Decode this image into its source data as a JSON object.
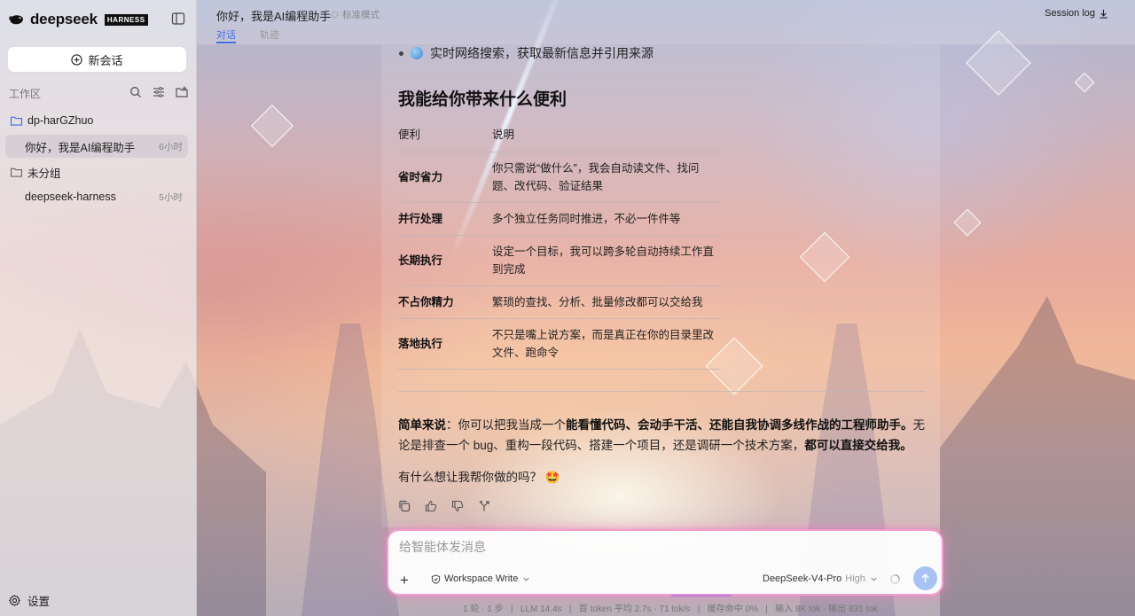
{
  "sidebar": {
    "brand_name": "deepseek",
    "brand_tag": "HARNESS",
    "new_chat_label": "新会话",
    "workspace_label": "工作区",
    "tree": [
      {
        "label": "dp-harGZhuo",
        "type": "folder",
        "time": ""
      },
      {
        "label": "你好，我是AI编程助手",
        "type": "chat",
        "time": "6小时",
        "selected": true
      },
      {
        "label": "未分组",
        "type": "folder",
        "time": ""
      },
      {
        "label": "deepseek-harness",
        "type": "chat",
        "time": "5小时"
      }
    ],
    "settings_label": "设置"
  },
  "header": {
    "title": "你好，我是AI编程助手",
    "mode": "标准模式",
    "tabs": [
      {
        "label": "对话",
        "active": true
      },
      {
        "label": "轨迹",
        "active": false
      }
    ],
    "session_log": "Session log"
  },
  "message": {
    "bullet": "实时网络搜索，获取最新信息并引用来源",
    "section_title": "我能给你带来什么便利",
    "table_headers": [
      "便利",
      "说明"
    ],
    "table_rows": [
      [
        "省时省力",
        "你只需说“做什么”，我会自动读文件、找问题、改代码、验证结果"
      ],
      [
        "并行处理",
        "多个独立任务同时推进，不必一件件等"
      ],
      [
        "长期执行",
        "设定一个目标，我可以跨多轮自动持续工作直到完成"
      ],
      [
        "不占你精力",
        "繁琐的查找、分析、批量修改都可以交给我"
      ],
      [
        "落地执行",
        "不只是嘴上说方案，而是真正在你的目录里改文件、跑命令"
      ]
    ],
    "summary_lead": "简单来说",
    "summary_part1": "：你可以把我当成一个",
    "summary_bold": "能看懂代码、会动手干活、还能自我协调多线作战的工程师助手。",
    "summary_part2": "无论是排查一个 bug、重构一段代码、搭建一个项目，还是调研一个技术方案，",
    "summary_bold2": "都可以直接交给我。",
    "question": "有什么想让我帮你做的吗？",
    "question_emoji": "🤩"
  },
  "composer": {
    "placeholder": "给智能体发消息",
    "value": "",
    "permission": "Workspace Write",
    "model": "DeepSeek-V4-Pro",
    "level": "High"
  },
  "status": {
    "text": "1 轮 · 1 步   |   LLM 14.4s   |   首 token 平均 2.7s · 71 tok/s   |   缓存命中 0%   |   输入 8K tok · 输出 831 tok"
  },
  "colors": {
    "accent": "#3f6fe0",
    "composer_glow": "#f29ccf",
    "send_button": "#a8c3f3"
  }
}
